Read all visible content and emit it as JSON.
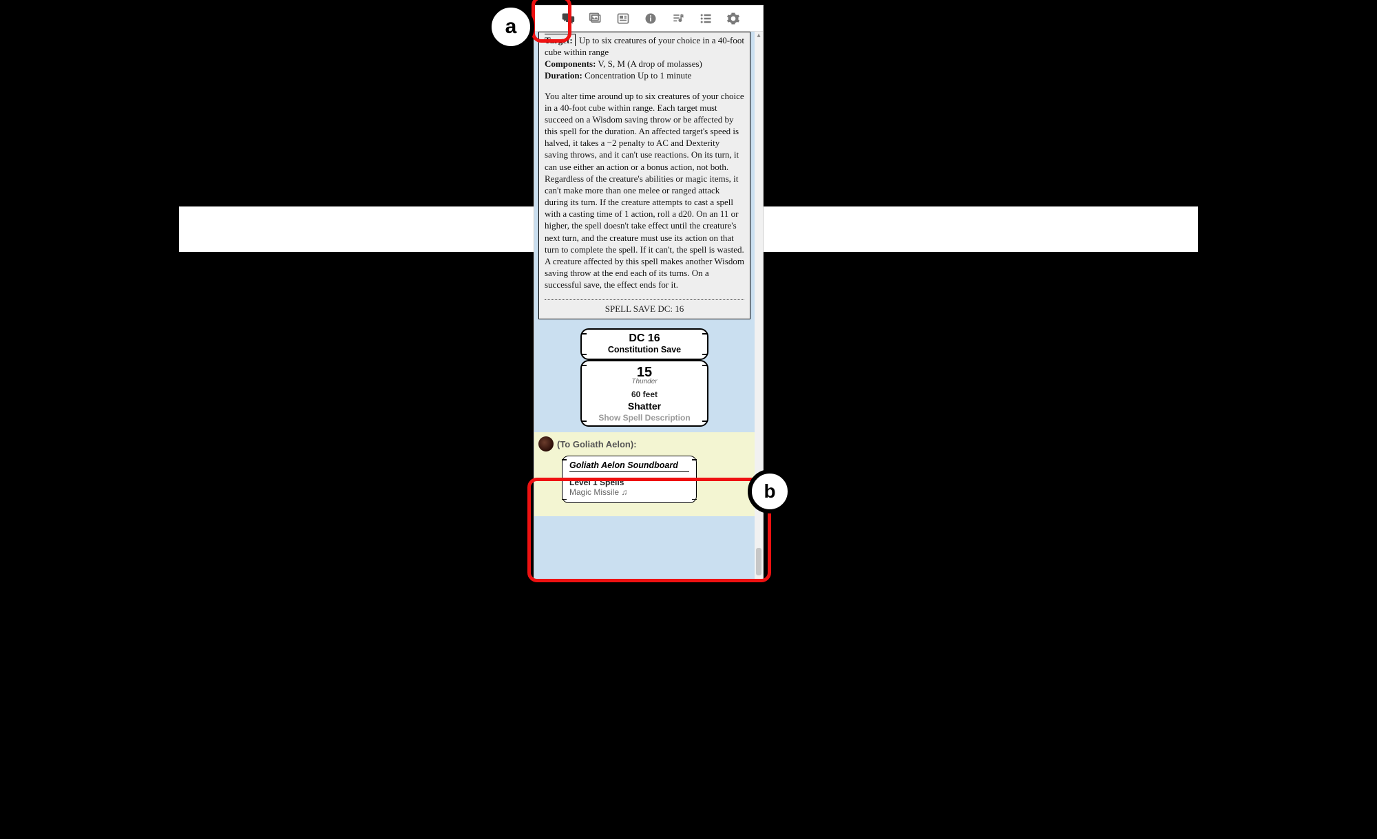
{
  "annotations": {
    "a": "a",
    "b": "b"
  },
  "toolbar": {
    "chat": "Chat",
    "art": "Art Library",
    "journal": "Journal",
    "compendium": "Compendium",
    "jukebox": "Jukebox",
    "collections": "Collections",
    "settings": "Settings"
  },
  "spell": {
    "target_label": "Target:",
    "target_value": "Up to six creatures of your choice in a 40-foot cube within range",
    "components_label": "Components:",
    "components_value": "V, S, M (A drop of molasses)",
    "duration_label": "Duration:",
    "duration_value": "Concentration Up to 1 minute",
    "description": "You alter time around up to six creatures of your choice in a 40-foot cube within range. Each target must succeed on a Wisdom saving throw or be affected by this spell for the duration. An affected target's speed is halved, it takes a −2 penalty to AC and Dexterity saving throws, and it can't use reactions. On its turn, it can use either an action or a bonus action, not both. Regardless of the creature's abilities or magic items, it can't make more than one melee or ranged attack during its turn. If the creature attempts to cast a spell with a casting time of 1 action, roll a d20. On an 11 or higher, the spell doesn't take effect until the creature's next turn, and the creature must use its action on that turn to complete the spell. If it can't, the spell is wasted. A creature affected by this spell makes another Wisdom saving throw at the end each of its turns. On a successful save, the effect ends for it.",
    "save_dc_line": "SPELL SAVE DC: 16"
  },
  "roll": {
    "dc": "DC 16",
    "save": "Constitution Save",
    "value": "15",
    "damage_type": "Thunder",
    "range": "60 feet",
    "spell_name": "Shatter",
    "show_desc": "Show Spell Description"
  },
  "whisper": {
    "to_line": "(To Goliath Aelon):",
    "title": "Goliath Aelon Soundboard",
    "section": "Level 1 Spells",
    "item": "Magic Missile ♫"
  }
}
